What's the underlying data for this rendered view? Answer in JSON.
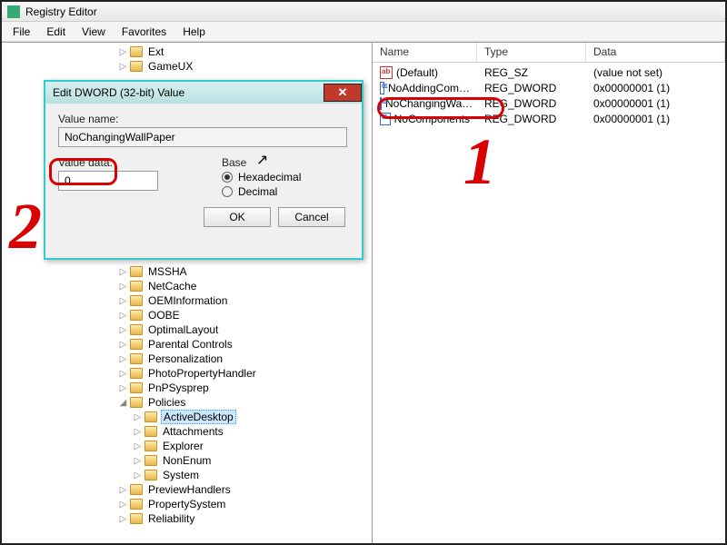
{
  "window": {
    "title": "Registry Editor"
  },
  "menu": {
    "file": "File",
    "edit": "Edit",
    "view": "View",
    "favorites": "Favorites",
    "help": "Help"
  },
  "columns": {
    "name": "Name",
    "type": "Type",
    "data": "Data"
  },
  "rows": [
    {
      "icon": "ab",
      "name": "(Default)",
      "type": "REG_SZ",
      "data": "(value not set)"
    },
    {
      "icon": "dw",
      "name": "NoAddingCom…",
      "type": "REG_DWORD",
      "data": "0x00000001 (1)"
    },
    {
      "icon": "dw",
      "name": "NoChangingWa…",
      "type": "REG_DWORD",
      "data": "0x00000001 (1)"
    },
    {
      "icon": "dw",
      "name": "NoComponents",
      "type": "REG_DWORD",
      "data": "0x00000001 (1)"
    }
  ],
  "tree": [
    {
      "indent": 8,
      "label": "Ext"
    },
    {
      "indent": 8,
      "label": "GameUX"
    },
    {
      "indent": 8,
      "label": "MSSHA"
    },
    {
      "indent": 8,
      "label": "NetCache"
    },
    {
      "indent": 8,
      "label": "OEMInformation"
    },
    {
      "indent": 8,
      "label": "OOBE"
    },
    {
      "indent": 8,
      "label": "OptimalLayout"
    },
    {
      "indent": 8,
      "label": "Parental Controls"
    },
    {
      "indent": 8,
      "label": "Personalization"
    },
    {
      "indent": 8,
      "label": "PhotoPropertyHandler"
    },
    {
      "indent": 8,
      "label": "PnPSysprep"
    },
    {
      "indent": 8,
      "label": "Policies",
      "expanded": true
    },
    {
      "indent": 9,
      "label": "ActiveDesktop",
      "selected": true
    },
    {
      "indent": 9,
      "label": "Attachments"
    },
    {
      "indent": 9,
      "label": "Explorer"
    },
    {
      "indent": 9,
      "label": "NonEnum"
    },
    {
      "indent": 9,
      "label": "System"
    },
    {
      "indent": 8,
      "label": "PreviewHandlers"
    },
    {
      "indent": 8,
      "label": "PropertySystem"
    },
    {
      "indent": 8,
      "label": "Reliability"
    }
  ],
  "dialog": {
    "title": "Edit DWORD (32-bit) Value",
    "value_name_label": "Value name:",
    "value_name": "NoChangingWallPaper",
    "value_data_label": "Value data:",
    "value_data": "0",
    "base_label": "Base",
    "hex": "Hexadecimal",
    "dec": "Decimal",
    "ok": "OK",
    "cancel": "Cancel"
  },
  "annotations": {
    "one": "1",
    "two": "2"
  }
}
